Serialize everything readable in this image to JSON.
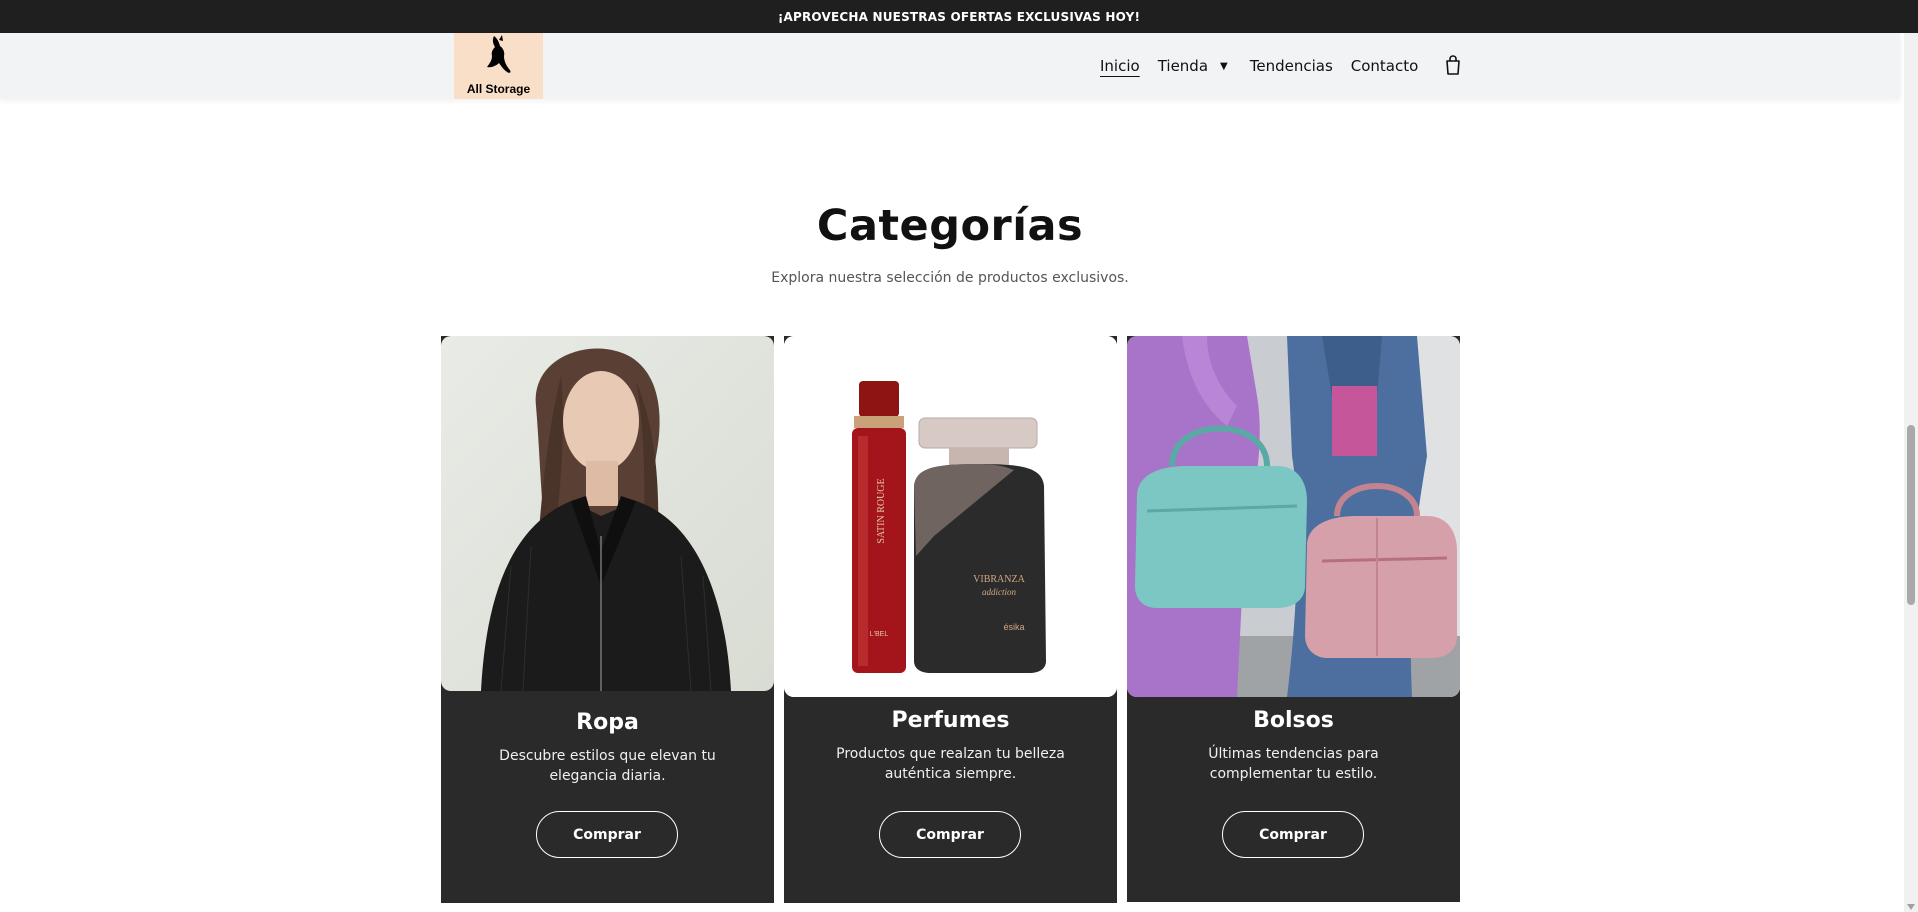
{
  "promo": {
    "text": "¡APROVECHA NUESTRAS OFERTAS EXCLUSIVAS HOY!"
  },
  "header": {
    "logo_text": "All Storage",
    "nav": {
      "inicio": "Inicio",
      "tienda": "Tienda",
      "tendencias": "Tendencias",
      "contacto": "Contacto"
    },
    "cart_icon": "shopping-bag-icon"
  },
  "section": {
    "title": "Categorías",
    "subtitle": "Explora nuestra selección de productos exclusivos."
  },
  "categories": [
    {
      "title": "Ropa",
      "description": "Descubre estilos que elevan tu elegancia diaria.",
      "button": "Comprar",
      "image": "woman-in-black-jacket-photo"
    },
    {
      "title": "Perfumes",
      "description": "Productos que realzan tu belleza auténtica siempre.",
      "button": "Comprar",
      "image": "perfume-bottles-photo",
      "image_text": {
        "bottle1_label": "SATIN ROUGE",
        "bottle1_brand": "L'BEL",
        "bottle2_label": "VIBRANZA",
        "bottle2_sub": "addiction",
        "bottle2_brand": "ésika"
      }
    },
    {
      "title": "Bolsos",
      "description": "Últimas tendencias para complementar tu estilo.",
      "button": "Comprar",
      "image": "women-holding-duffel-bags-photo"
    }
  ],
  "colors": {
    "promo_bg": "#1f1f1f",
    "header_bg": "#f2f3f5",
    "logo_bg": "#f9dfc8",
    "card_bg": "#2a2a2a"
  }
}
